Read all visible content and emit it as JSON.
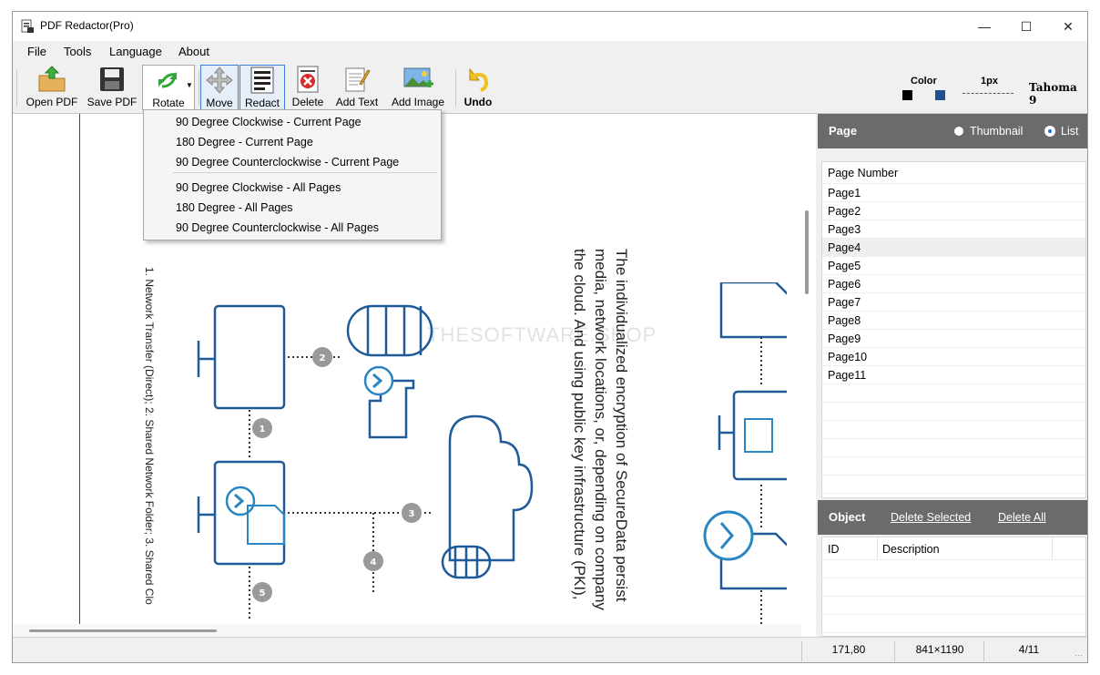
{
  "window": {
    "title": "PDF Redactor(Pro)"
  },
  "menu": [
    "File",
    "Tools",
    "Language",
    "About"
  ],
  "toolbar": {
    "open_pdf": "Open PDF",
    "save_pdf": "Save PDF",
    "rotate": "Rotate",
    "move": "Move",
    "redact": "Redact",
    "delete": "Delete",
    "add_text": "Add Text",
    "add_image": "Add Image",
    "undo": "Undo",
    "color_label": "Color",
    "stroke_label": "1px",
    "font_label": "Tahoma 9",
    "color_a": "#000000",
    "color_b": "#1f4f91"
  },
  "rotate_menu": {
    "items": [
      "90 Degree Clockwise - Current Page",
      "180 Degree - Current Page",
      "90 Degree Counterclockwise - Current Page",
      "90 Degree Clockwise - All Pages",
      "180 Degree - All Pages",
      "90 Degree Counterclockwise - All Pages"
    ]
  },
  "document": {
    "paragraph_lines": [
      "The individualized encryption of SecureData persist",
      "media, network locations, or, depending on company",
      "the cloud. And using public key infrastructure (PKI),"
    ],
    "caption": "1. Network Transfer (Direct); 2. Shared Network Folder; 3. Shared Clo",
    "watermark": "THESOFTWARE.SHOP",
    "step_labels": [
      "1",
      "2",
      "3",
      "4",
      "5"
    ]
  },
  "page_panel": {
    "header": "Page",
    "thumbnail_label": "Thumbnail",
    "list_label": "List",
    "column_header": "Page Number",
    "pages": [
      "Page1",
      "Page2",
      "Page3",
      "Page4",
      "Page5",
      "Page6",
      "Page7",
      "Page8",
      "Page9",
      "Page10",
      "Page11"
    ],
    "selected_index": 3
  },
  "object_panel": {
    "header": "Object",
    "delete_selected": "Delete Selected",
    "delete_all": "Delete All",
    "col_id": "ID",
    "col_description": "Description"
  },
  "status": {
    "coords": "171,80",
    "page_size": "841×1190",
    "page_index": "4/11"
  }
}
